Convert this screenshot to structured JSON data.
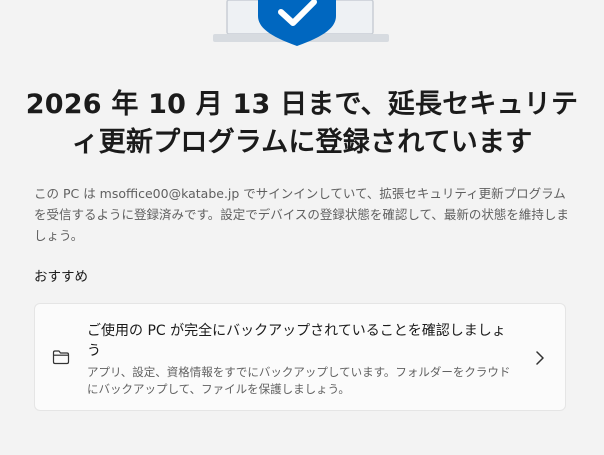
{
  "header": {
    "title": "2026 年 10 月 13 日まで、延長セキュリティ更新プログラムに登録されています"
  },
  "main": {
    "description": "この PC は msoffice00@katabe.jp でサインインしていて、拡張セキュリティ更新プログラムを受信するように登録済みです。設定でデバイスの登録状態を確認して、最新の状態を維持しましょう。",
    "recommendations_label": "おすすめ",
    "card": {
      "title": "ご使用の PC が完全にバックアップされていることを確認しましょう",
      "description": "アプリ、設定、資格情報をすでにバックアップしています。フォルダーをクラウドにバックアップして、ファイルを保護しましょう。",
      "icon": "folder-icon",
      "chevron": "chevron-right-icon"
    }
  },
  "colors": {
    "background": "#f3f3f3",
    "shield": "#0067c0",
    "laptop": "#d7dbe0",
    "card_background": "#fbfbfb",
    "card_border": "#e5e5e5"
  }
}
